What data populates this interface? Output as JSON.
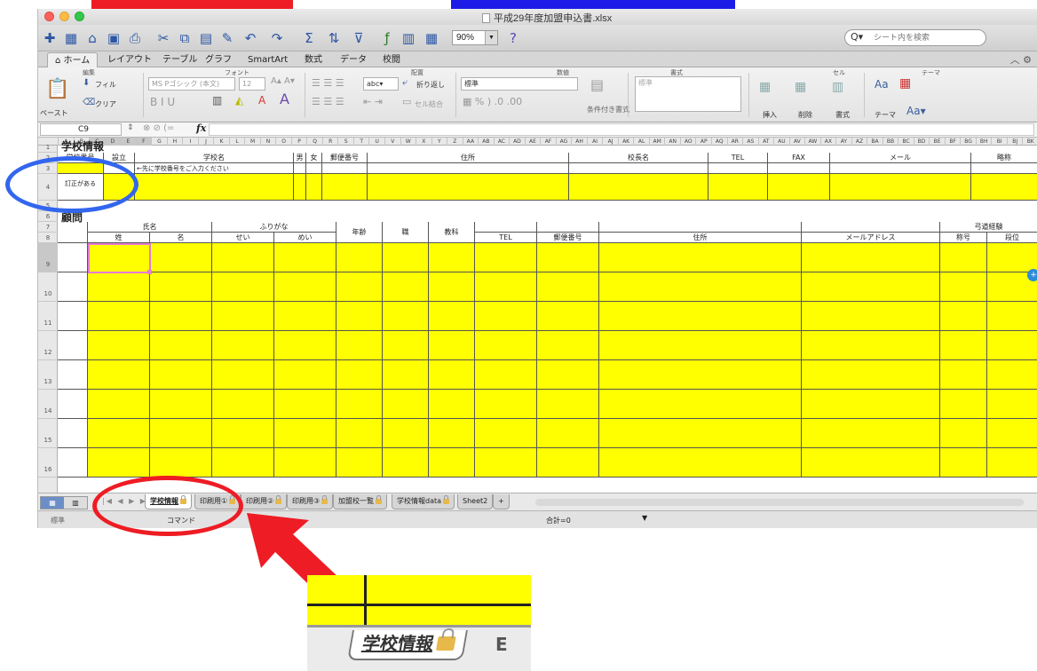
{
  "window": {
    "title": "平成29年度加盟申込書.xlsx",
    "zoom": "90%",
    "search_placeholder": "シート内を検索"
  },
  "ribbon_tabs": [
    "ホーム",
    "レイアウト",
    "テーブル",
    "グラフ",
    "SmartArt",
    "数式",
    "データ",
    "校閲"
  ],
  "ribbon": {
    "groups": [
      "編集",
      "フォント",
      "配置",
      "数値",
      "書式",
      "セル",
      "テーマ"
    ],
    "fill_label": "フィル",
    "clear_label": "クリア",
    "paste_label": "ペースト",
    "font_name": "MS Pゴシック (本文)",
    "font_size": "12",
    "wrap_label": "折り返し",
    "merge_label": "セル結合",
    "number_format": "標準",
    "cond_format": "条件付き書式",
    "style_value": "標準",
    "insert_label": "挿入",
    "delete_label": "削除",
    "format_label": "書式",
    "theme_label": "テーマ"
  },
  "formula_bar": {
    "cell_ref": "C9",
    "fx": "fx"
  },
  "columns": [
    "A",
    "B",
    "C",
    "D",
    "E",
    "F",
    "G",
    "H",
    "I",
    "J",
    "K",
    "L",
    "M",
    "N",
    "O",
    "P",
    "Q",
    "R",
    "S",
    "T",
    "U",
    "V",
    "W",
    "X",
    "Y",
    "Z",
    "AA",
    "AB",
    "AC",
    "AD",
    "AE",
    "AF",
    "AG",
    "AH",
    "AI",
    "AJ",
    "AK",
    "AL",
    "AM",
    "AN",
    "AO",
    "AP",
    "AQ",
    "AR",
    "AS",
    "AT",
    "AU",
    "AV",
    "AW",
    "AX",
    "AY",
    "AZ",
    "BA",
    "BB",
    "BC",
    "BD",
    "BE",
    "BF",
    "BG",
    "BH",
    "BI",
    "BJ",
    "BK"
  ],
  "rows": [
    "1",
    "2",
    "3",
    "4",
    "5",
    "6",
    "7",
    "8",
    "9",
    "10",
    "11",
    "12",
    "13",
    "14",
    "15",
    "16"
  ],
  "school_section": {
    "title": "学校情報",
    "headers": [
      "学校番号",
      "設立",
      "学校名",
      "男",
      "女",
      "郵便番号",
      "住所",
      "校長名",
      "TEL",
      "FAX",
      "メール",
      "略称"
    ],
    "hint": "←先に学校番号をご入力ください",
    "correction_label": "訂正がある"
  },
  "advisor_section": {
    "title": "顧問",
    "group_headers": [
      "氏名",
      "ふりがな",
      "弓道経験"
    ],
    "headers": [
      "姓",
      "名",
      "せい",
      "めい",
      "年齢",
      "職",
      "教科",
      "TEL",
      "郵便番号",
      "住所",
      "メールアドレス",
      "称号",
      "段位"
    ]
  },
  "sheet_tabs": [
    {
      "label": "学校情報",
      "locked": true,
      "active": true
    },
    {
      "label": "印刷用①",
      "locked": true,
      "active": false
    },
    {
      "label": "印刷用②",
      "locked": true,
      "active": false
    },
    {
      "label": "印刷用③",
      "locked": true,
      "active": false
    },
    {
      "label": "加盟校一覧",
      "locked": true,
      "active": false
    },
    {
      "label": "学校情報data",
      "locked": true,
      "active": false
    },
    {
      "label": "Sheet2",
      "locked": false,
      "active": false
    }
  ],
  "add_sheet": "+",
  "status": {
    "ready": "標準",
    "mode": "コマンド",
    "sum": "合計=0"
  },
  "inset": {
    "tab_label": "学校情報",
    "next_tab_fragment": "E"
  },
  "colors": {
    "highlight_yellow": "#ffff00",
    "annotation_red": "#ee1c24",
    "annotation_blue": "#3366ee"
  }
}
